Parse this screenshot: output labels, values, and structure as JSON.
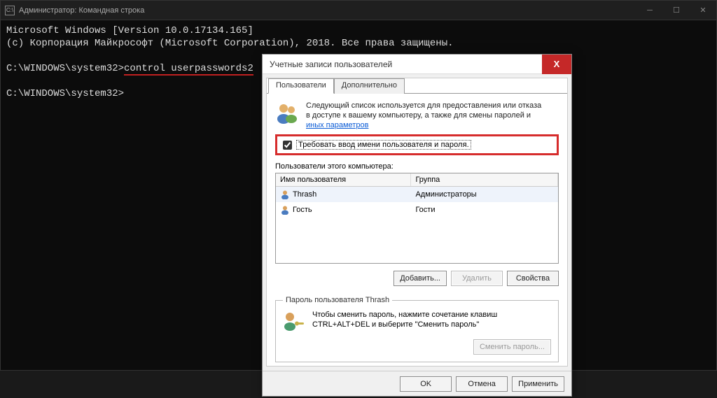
{
  "cmd": {
    "title": "Администратор: Командная строка",
    "line1": "Microsoft Windows [Version 10.0.17134.165]",
    "line2": "(c) Корпорация Майкрософт (Microsoft Corporation), 2018. Все права защищены.",
    "prompt1_prefix": "C:\\WINDOWS\\system32>",
    "prompt1_command": "control userpasswords2",
    "prompt2": "C:\\WINDOWS\\system32>"
  },
  "dialog": {
    "title": "Учетные записи пользователей",
    "tabs": {
      "users": "Пользователи",
      "advanced": "Дополнительно"
    },
    "description_line1": "Следующий список используется для предоставления или отказа",
    "description_line2": "в доступе к вашему компьютеру, а также для смены паролей и",
    "description_link": "иных параметров",
    "checkbox_label": "Требовать ввод имени пользователя и пароля.",
    "list_label": "Пользователи этого компьютера:",
    "columns": {
      "user": "Имя пользователя",
      "group": "Группа"
    },
    "rows": [
      {
        "user": "Thrash",
        "group": "Администраторы"
      },
      {
        "user": "Гость",
        "group": "Гости"
      }
    ],
    "buttons": {
      "add": "Добавить...",
      "delete": "Удалить",
      "properties": "Свойства"
    },
    "pw_group_legend": "Пароль пользователя Thrash",
    "pw_text_line1": "Чтобы сменить пароль, нажмите сочетание клавиш",
    "pw_text_line2": "CTRL+ALT+DEL и выберите \"Сменить пароль\"",
    "pw_button": "Сменить пароль...",
    "ok": "OK",
    "cancel": "Отмена",
    "apply": "Применить"
  }
}
